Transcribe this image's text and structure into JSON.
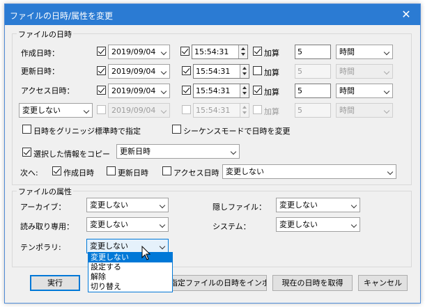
{
  "window": {
    "title": "ファイルの日時/属性を変更",
    "close": "✕"
  },
  "datetime_group": {
    "label": "ファイルの日時",
    "rows": {
      "created": {
        "label": "作成日時：",
        "date": "2019/09/04",
        "time": "15:54:31",
        "add_label": "加算",
        "add_value": "5",
        "unit": "時間"
      },
      "modified": {
        "label": "更新日時：",
        "date": "2019/09/04",
        "time": "15:54:31",
        "add_label": "加算",
        "add_value": "5",
        "unit": "時間"
      },
      "accessed": {
        "label": "アクセス日時：",
        "date": "2019/09/04",
        "time": "15:54:31",
        "add_label": "加算",
        "add_value": "5",
        "unit": "時間"
      },
      "fourth": {
        "select": "変更しない",
        "date": "2019/09/04",
        "time": "15:54:31",
        "add_label": "加算",
        "add_value": "5",
        "unit": "時間"
      }
    },
    "gmt_label": "日時をグリニッジ標準時で指定",
    "sequence_label": "シーケンスモードで日時を変更",
    "copy_label": "選択した情報をコピー",
    "copy_select": "更新日時",
    "next_label": "次へ:",
    "next_created": "作成日時",
    "next_modified": "更新日時",
    "next_accessed": "アクセス日時",
    "next_select": "変更しない"
  },
  "attr_group": {
    "label": "ファイルの属性",
    "archive_label": "アーカイブ：",
    "archive_value": "変更しない",
    "readonly_label": "読み取り専用：",
    "readonly_value": "変更しない",
    "temporary_label": "テンポラリ:",
    "temporary_value": "変更しない",
    "hidden_label": "隠しファイル：",
    "hidden_value": "変更しない",
    "system_label": "システム：",
    "system_value": "変更しない",
    "dropdown_options": [
      "変更しない",
      "設定する",
      "解除",
      "切り替え"
    ]
  },
  "buttons": {
    "run": "実行",
    "import": "指定ファイルの日時をインポート",
    "get_now": "現在の日時を取得",
    "cancel": "キャンセル"
  }
}
